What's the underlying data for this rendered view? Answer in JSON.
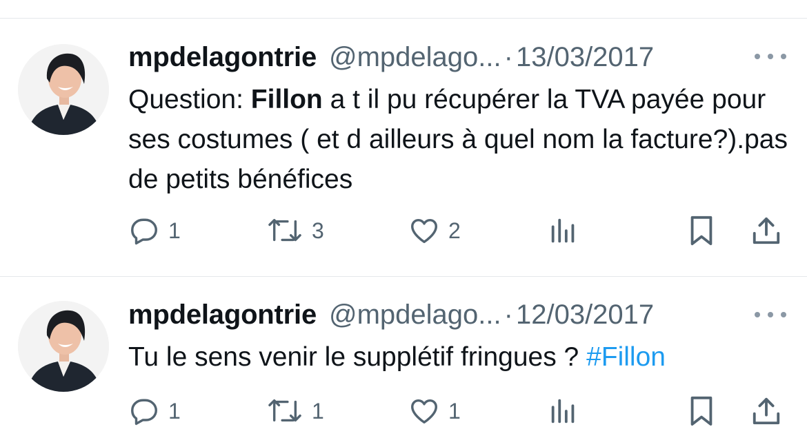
{
  "tweets": [
    {
      "name": "mpdelagontrie",
      "handle": "@mpdelago...",
      "separator": "·",
      "date": "13/03/2017",
      "text_parts": [
        "Question: ",
        "Fillon",
        " a t il pu récupérer  la TVA payée pour ses costumes ( et d ailleurs à quel nom la facture?).pas de petits bénéfices"
      ],
      "replies": "1",
      "retweets": "3",
      "likes": "2"
    },
    {
      "name": "mpdelagontrie",
      "handle": "@mpdelago...",
      "separator": "·",
      "date": "12/03/2017",
      "text_parts": [
        "Tu le sens venir le supplétif fringues ? ",
        "#Fillon"
      ],
      "replies": "1",
      "retweets": "1",
      "likes": "1"
    }
  ],
  "colors": {
    "text": "#0f1419",
    "secondary": "#536471",
    "hashtag": "#1d9bf0",
    "divider": "#e4e8eb"
  },
  "icons": [
    "reply-icon",
    "retweet-icon",
    "like-icon",
    "views-icon",
    "bookmark-icon",
    "share-icon",
    "more-icon"
  ]
}
